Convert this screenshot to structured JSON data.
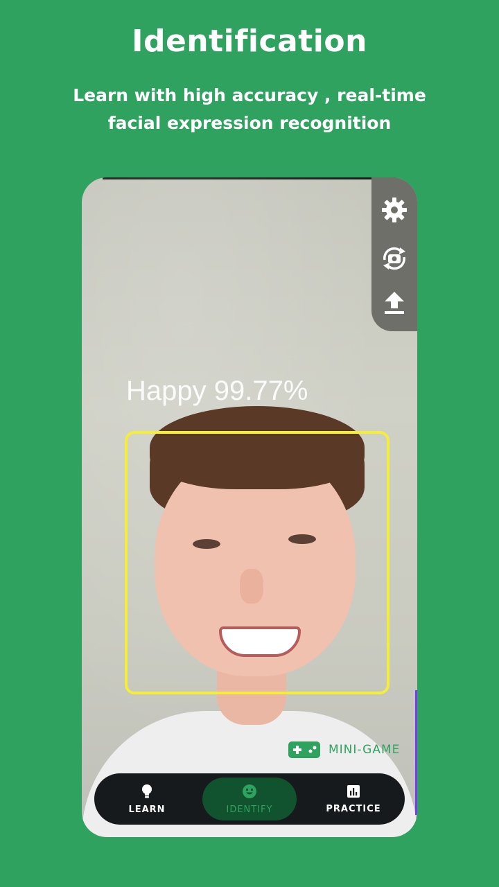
{
  "header": {
    "title": "Identification",
    "subtitle": "Learn with high accuracy , real-time facial expression recognition"
  },
  "camera": {
    "emotion_label": "Happy 99.77%",
    "detection_box_color": "#f4ee3b"
  },
  "action_bar": {
    "items": [
      {
        "icon": "gear-icon"
      },
      {
        "icon": "camera-flip-icon"
      },
      {
        "icon": "upload-icon"
      }
    ]
  },
  "mini_game": {
    "label": "MINI-GAME",
    "icon": "gamepad-icon"
  },
  "bottom_nav": {
    "items": [
      {
        "label": "LEARN",
        "icon": "lightbulb-icon",
        "active": false
      },
      {
        "label": "IDENTIFY",
        "icon": "smiley-icon",
        "active": true
      },
      {
        "label": "PRACTICE",
        "icon": "bar-chart-icon",
        "active": false
      }
    ]
  },
  "colors": {
    "background": "#2fa25f",
    "accent": "#2fa25f",
    "nav_background": "#161a1d",
    "nav_active_background": "#11522f"
  }
}
